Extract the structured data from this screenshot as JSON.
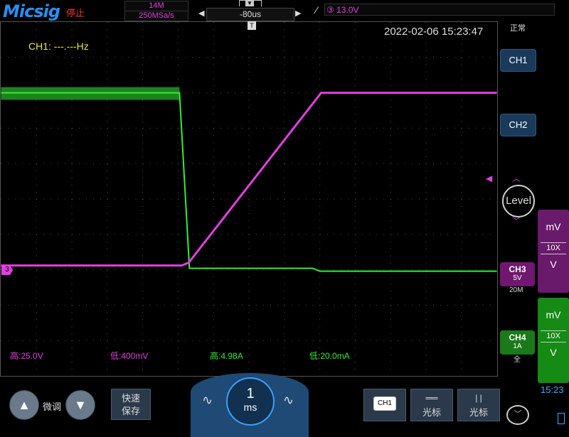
{
  "header": {
    "logo": "Micsig",
    "run_state": "停止",
    "memory_depth": "14M",
    "sample_rate": "250MSa/s",
    "trigger_position": "-80us",
    "trigger_level": "③ 13.0V",
    "status": "正常"
  },
  "screen": {
    "timestamp": "2022-02-06 15:23:47",
    "frequency": "CH1: ---.---Hz",
    "trigger_marker": "T",
    "ch3_marker": "3",
    "measurements": [
      {
        "label": "高:25.0V",
        "color": "#e040e0"
      },
      {
        "label": "低:400mV",
        "color": "#e040e0"
      },
      {
        "label": "高:4.98A",
        "color": "#33ee33"
      },
      {
        "label": "低:20.0mA",
        "color": "#33ee33"
      }
    ]
  },
  "channels": {
    "ch1": {
      "label": "CH1"
    },
    "ch2": {
      "label": "CH2"
    },
    "ch3": {
      "label": "CH3",
      "scale": "5V",
      "bandwidth": "20M",
      "color": "#e040e0"
    },
    "ch4": {
      "label": "CH4",
      "scale": "1A",
      "bandwidth": "全",
      "color": "#33ee33"
    }
  },
  "level_knob": {
    "label": "Level"
  },
  "ch3_strip": {
    "top": "mV",
    "probe": "10X",
    "bottom": "V"
  },
  "ch4_strip": {
    "top": "mV",
    "probe": "10X",
    "bottom": "V"
  },
  "bottom": {
    "fine_label": "微调",
    "fast_save": [
      "快速",
      "保存"
    ],
    "timebase_value": "1",
    "timebase_unit": "ms",
    "ch1_select": "CH1",
    "cursor_h_label": "光标",
    "cursor_v_label": "光标"
  },
  "clock": "15:23",
  "icons": {
    "up": "triangle-up",
    "down": "triangle-down",
    "tb_left": "sine-wave",
    "tb_right": "sine-wave",
    "expand": "chevron-down"
  },
  "colors": {
    "ch3": "#e040e0",
    "ch4": "#33ee33",
    "accent": "#3aa0ff"
  }
}
